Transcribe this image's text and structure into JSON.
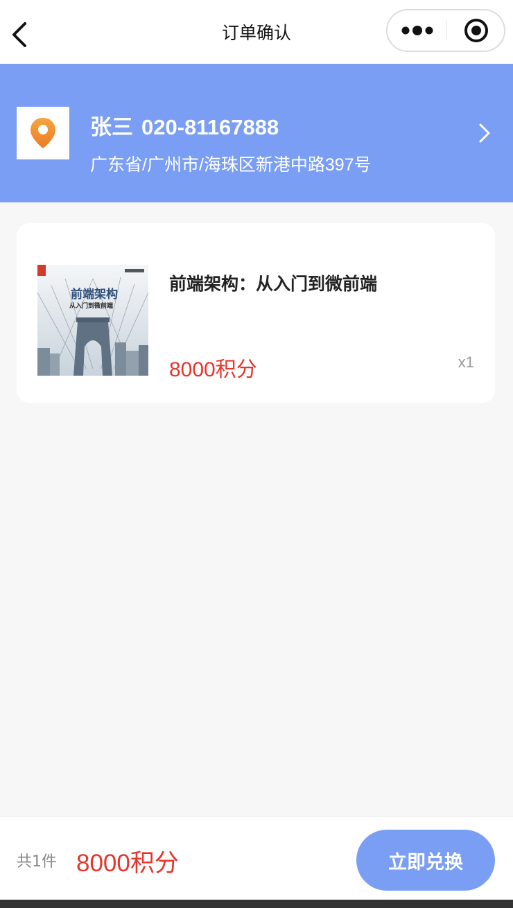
{
  "navbar": {
    "title": "订单确认",
    "back_icon": "chevron-left-icon",
    "menu_icon": "more-dots-icon",
    "close_icon": "target-circle-icon"
  },
  "address": {
    "name": "张三",
    "phone": "020-81167888",
    "detail": "广东省/广州市/海珠区新港中路397号",
    "icon": "location-pin-icon",
    "banner_color": "#7a9ef3"
  },
  "product": {
    "title": "前端架构：从入门到微前端",
    "price": "8000积分",
    "quantity": "x1",
    "cover": {
      "main_title": "前端架构",
      "sub_title": "从入门到微前端"
    }
  },
  "footer": {
    "count_label": "共1件",
    "total": "8000积分",
    "redeem_label": "立即兑换"
  },
  "colors": {
    "accent": "#7a9ef3",
    "price": "#e6352b"
  }
}
